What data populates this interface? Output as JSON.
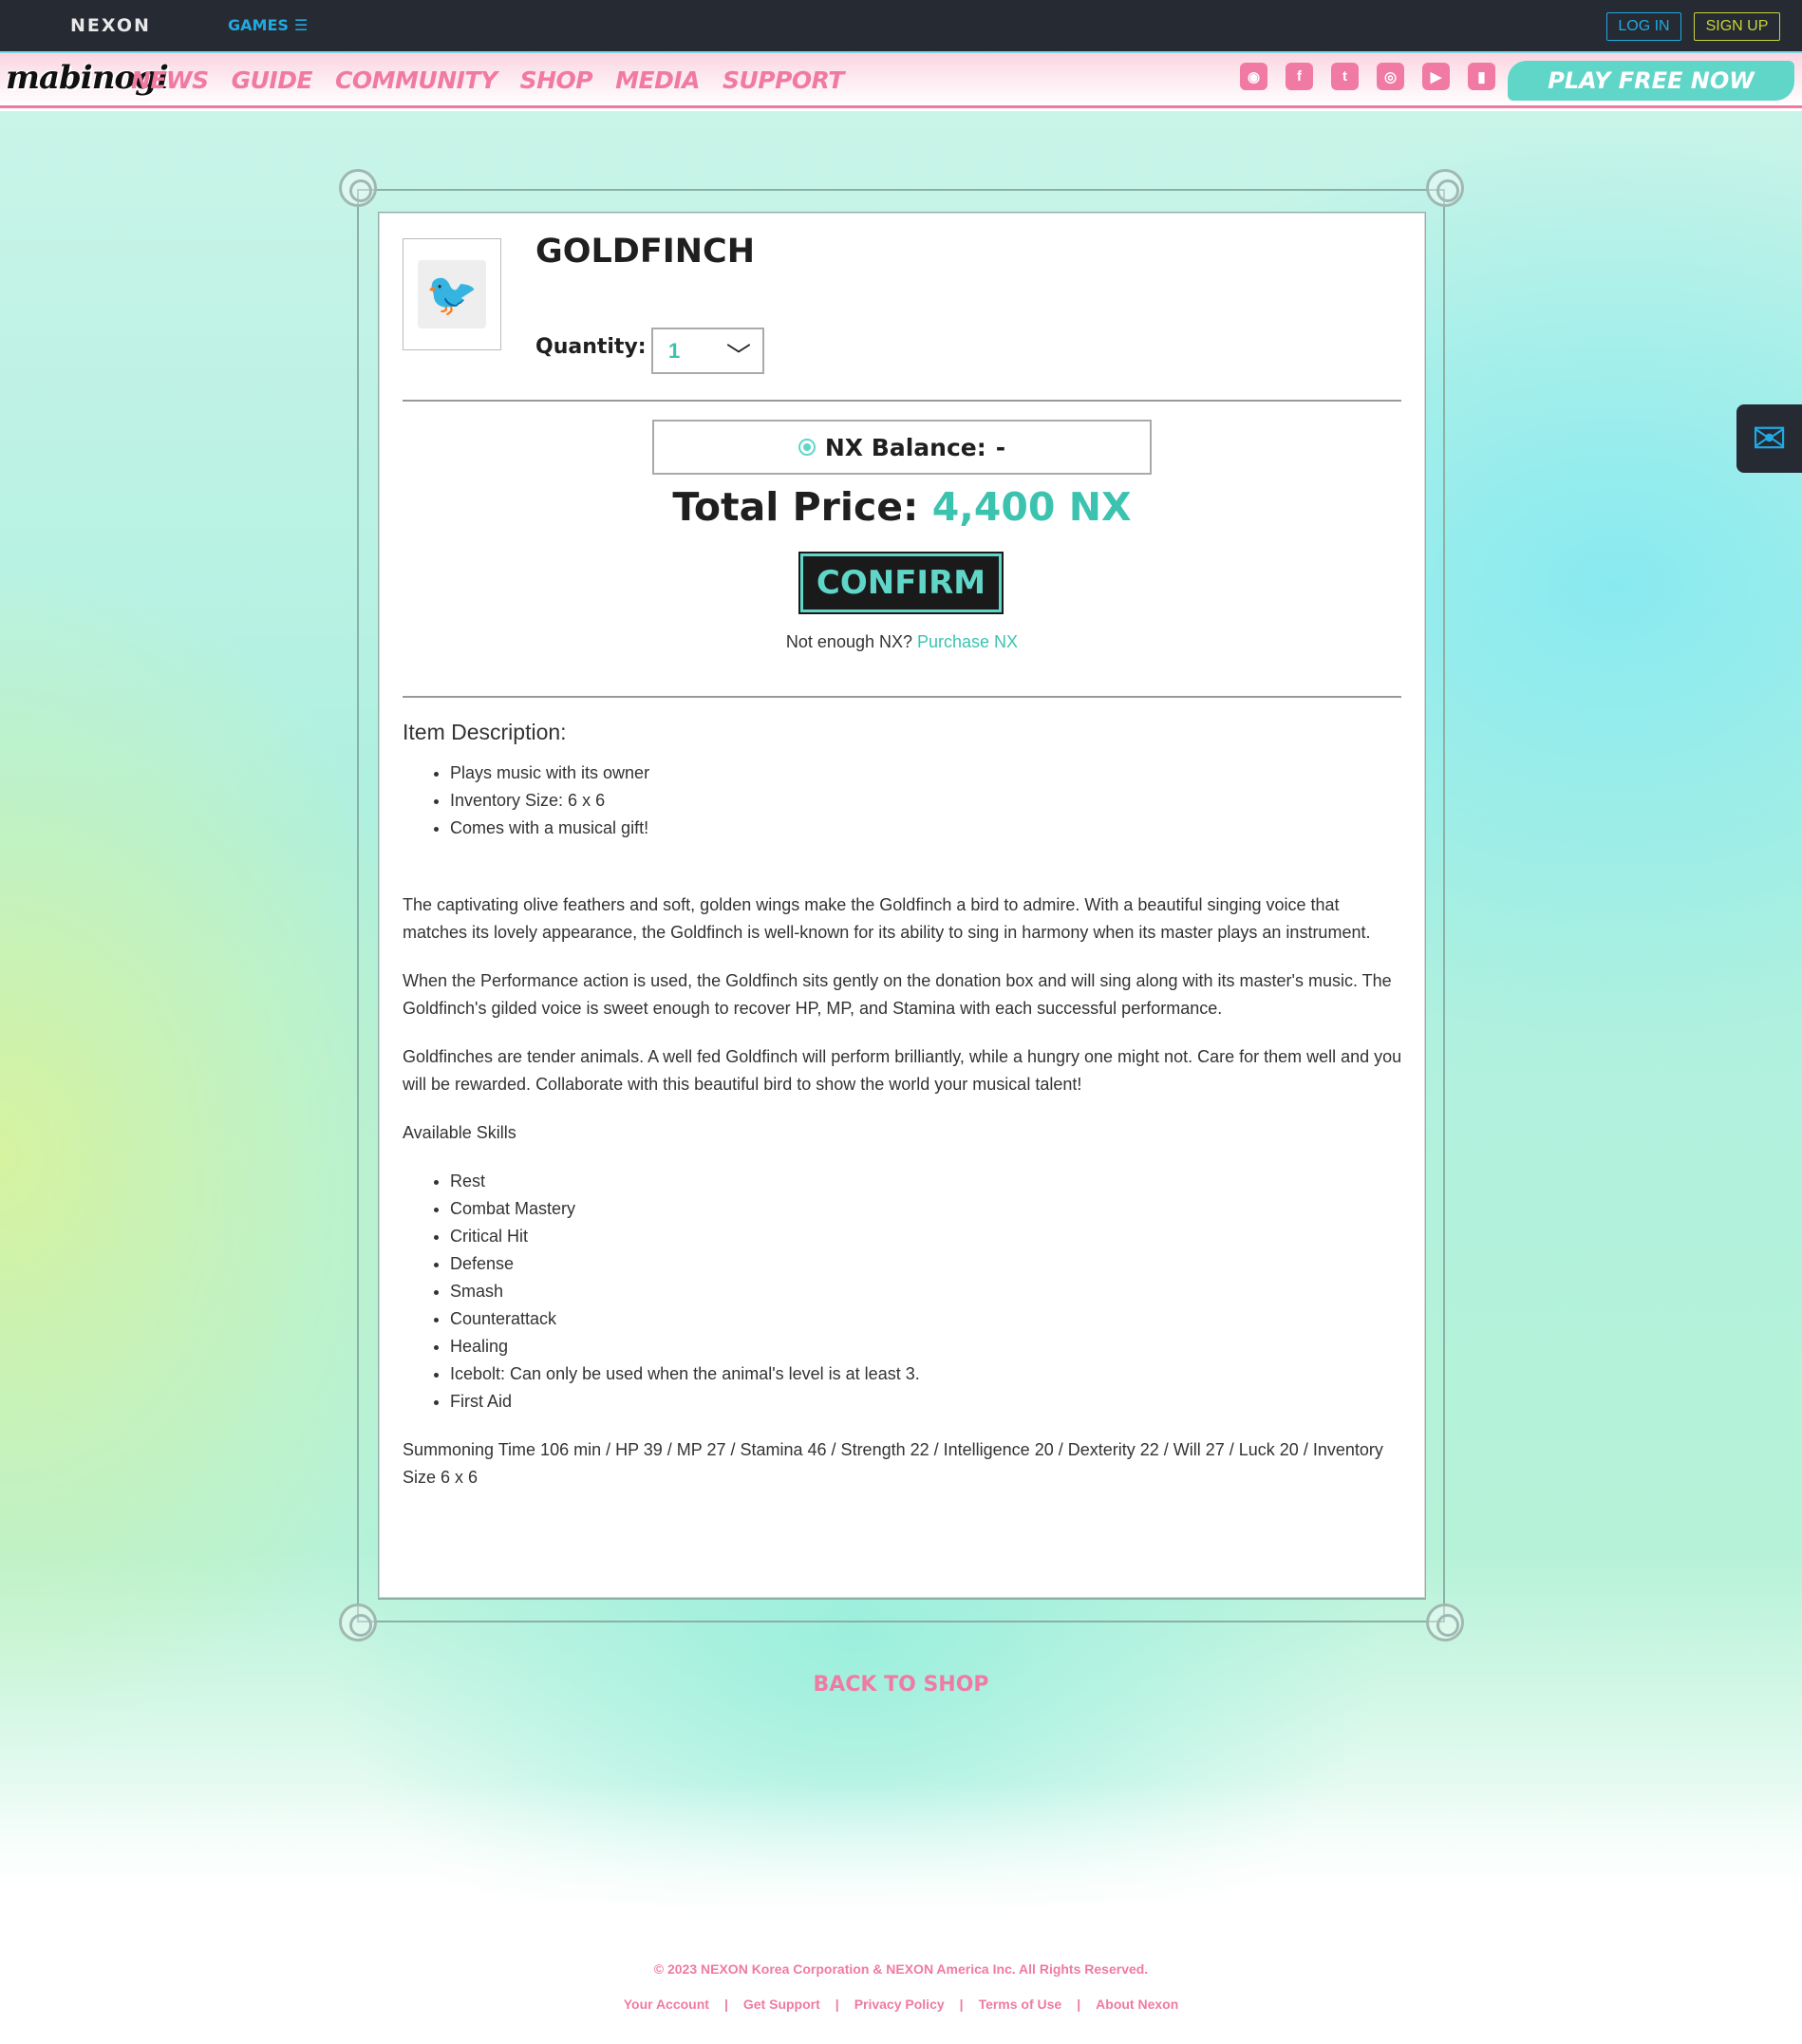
{
  "topbar": {
    "brand": "NEXON",
    "games_label": "GAMES",
    "login_label": "LOG IN",
    "signup_label": "SIGN UP"
  },
  "nav": {
    "logo_text": "mabinogi",
    "links": [
      "NEWS",
      "GUIDE",
      "COMMUNITY",
      "SHOP",
      "MEDIA",
      "SUPPORT"
    ],
    "socials": [
      {
        "name": "discord-icon",
        "glyph": "◉"
      },
      {
        "name": "facebook-icon",
        "glyph": "f"
      },
      {
        "name": "twitter-icon",
        "glyph": "t"
      },
      {
        "name": "instagram-icon",
        "glyph": "◎"
      },
      {
        "name": "youtube-icon",
        "glyph": "▶"
      },
      {
        "name": "twitch-icon",
        "glyph": "▮"
      }
    ],
    "play_label": "PLAY FREE NOW"
  },
  "item": {
    "title": "GOLDFINCH",
    "quantity_label": "Quantity:",
    "quantity_value": "1",
    "balance_label": "NX Balance:",
    "balance_value": "-",
    "total_label": "Total Price:",
    "total_value": "4,400 NX",
    "confirm_label": "CONFIRM",
    "not_enough_text": "Not enough NX?",
    "purchase_link": "Purchase NX"
  },
  "description": {
    "heading": "Item Description:",
    "bullets": [
      "Plays music with its owner",
      "Inventory Size: 6 x 6",
      "Comes with a musical gift!"
    ],
    "paragraphs": [
      "The captivating olive feathers and soft, golden wings make the Goldfinch a bird to admire. With a beautiful singing voice that matches its lovely appearance, the Goldfinch is well-known for its ability to sing in harmony when its master plays an instrument.",
      "When the Performance action is used, the Goldfinch sits gently on the donation box and will sing along with its master's music. The Goldfinch's gilded voice is sweet enough to recover HP, MP, and Stamina with each successful performance.",
      "Goldfinches are tender animals. A well fed Goldfinch will perform brilliantly, while a hungry one might not. Care for them well and you will be rewarded. Collaborate with this beautiful bird to show the world your musical talent!"
    ],
    "skills_heading": "Available Skills",
    "skills": [
      "Rest",
      "Combat Mastery",
      "Critical Hit",
      "Defense",
      "Smash",
      "Counterattack",
      "Healing",
      "Icebolt: Can only be used when the animal's level is at least 3.",
      "First Aid"
    ],
    "stats": "Summoning Time 106 min / HP 39 / MP 27 / Stamina 46 / Strength 22 / Intelligence 20 / Dexterity 22 / Will 27 / Luck 20 / Inventory Size 6 x 6"
  },
  "back_to_shop": "BACK TO SHOP",
  "footer": {
    "copyright": "© 2023 NEXON Korea Corporation & NEXON America Inc. All Rights Reserved.",
    "links": [
      "Your Account",
      "Get Support",
      "Privacy Policy",
      "Terms of Use",
      "About Nexon"
    ]
  },
  "colors": {
    "accent_pink": "#f07aa3",
    "accent_teal": "#3cc3b0",
    "topbar_bg": "#262a33",
    "link_blue": "#21a9e1"
  }
}
